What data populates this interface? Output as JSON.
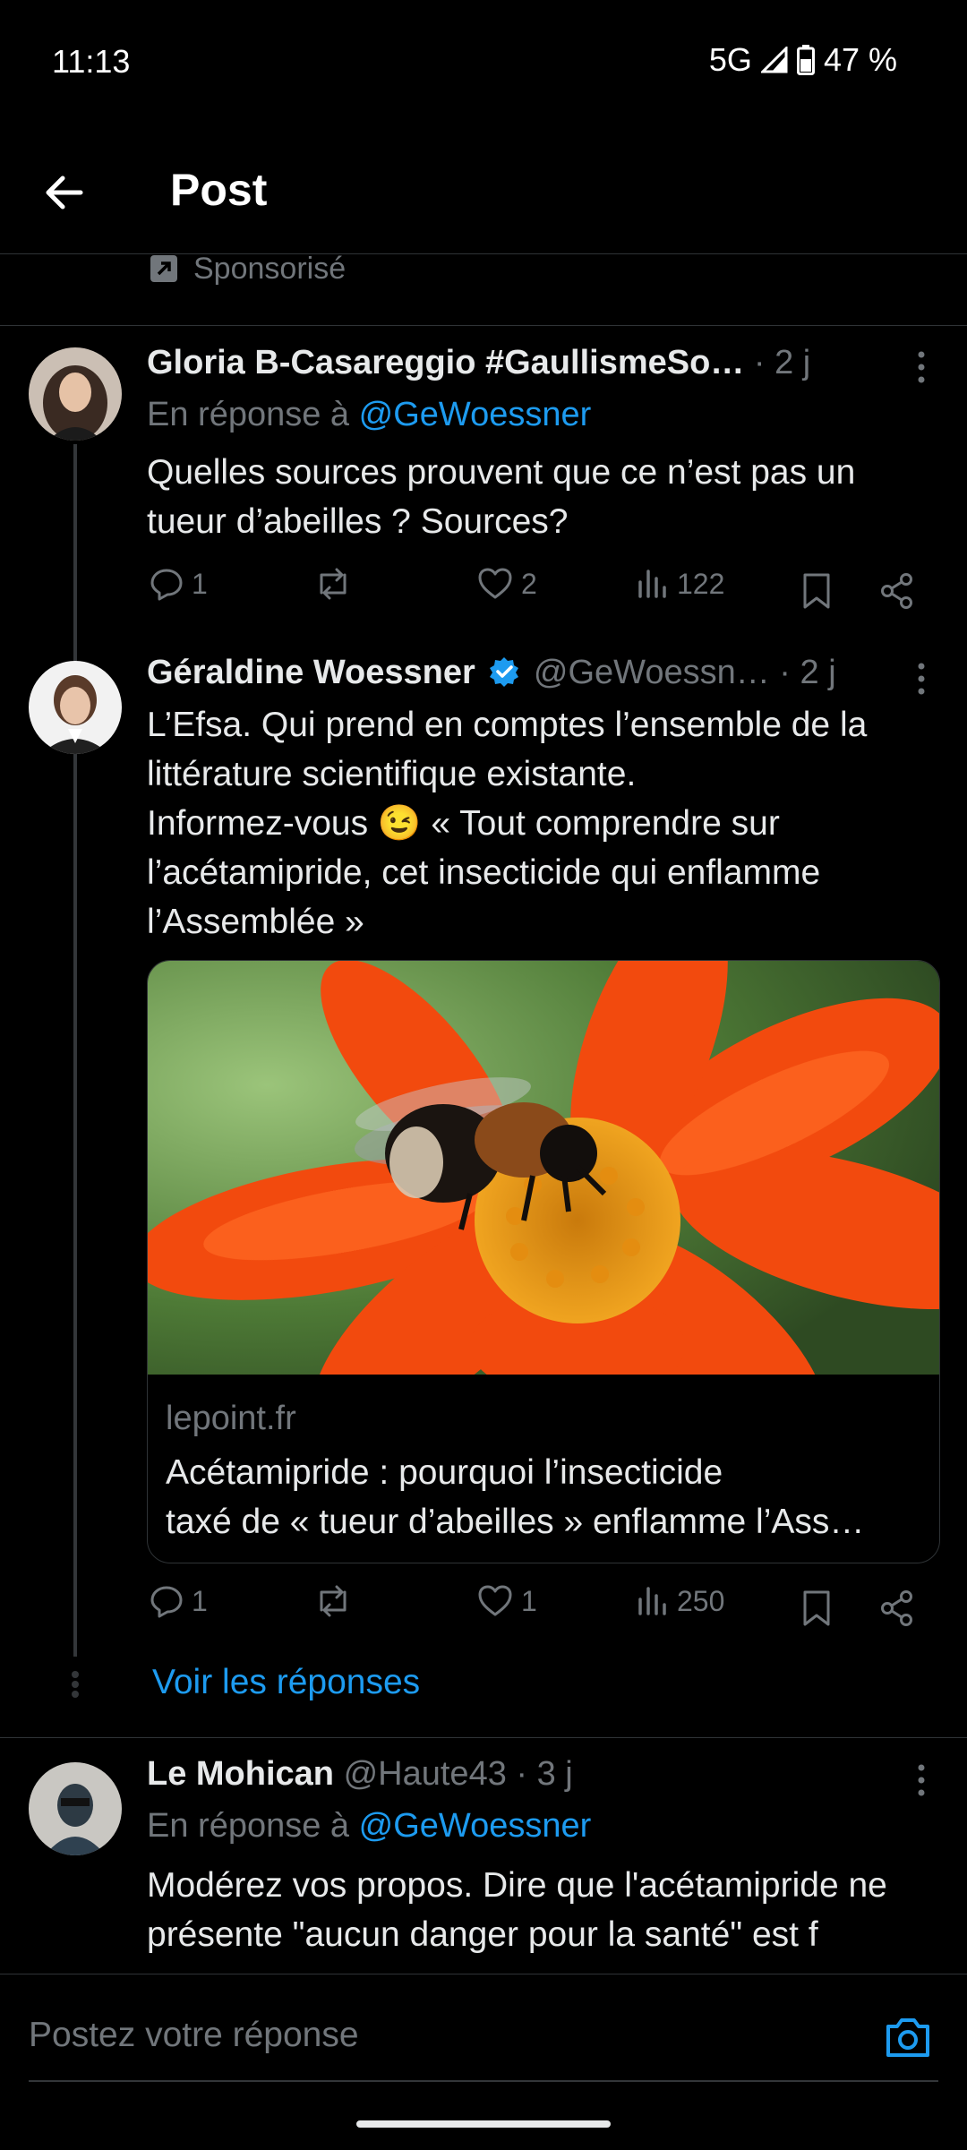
{
  "status_bar": {
    "time": "11:13",
    "network": "5G",
    "battery": "47 %"
  },
  "header": {
    "title": "Post"
  },
  "sponsored": {
    "label": "Sponsorisé"
  },
  "reply_prefix": "En réponse à",
  "tweets": [
    {
      "name": "Gloria B-Casareggio #GaullismeSo…",
      "meta": " · 2 j",
      "reply_handle": "@GeWoessner",
      "text": "Quelles sources prouvent que ce n’est pas un tueur d’abeilles ? Sources?",
      "replies": "1",
      "reposts": "",
      "likes": "2",
      "views": "122"
    },
    {
      "name": "Géraldine Woessner",
      "verified": true,
      "meta": "@GeWoessn… · 2 j",
      "text_line1": "L’Efsa. Qui prend en comptes l’ensemble de la littérature scientifique existante.",
      "text_line2_before": "Informez-vous ",
      "emoji": "😉",
      "text_line2_after": " « Tout comprendre sur l’acétamipride, cet insecticide qui enflamme l’Assemblée »",
      "card": {
        "domain": "lepoint.fr",
        "title_line1": "Acétamipride : pourquoi l’insecticide",
        "title_line2": "taxé de « tueur d’abeilles » enflamme l’Ass…"
      },
      "replies": "1",
      "reposts": "",
      "likes": "1",
      "views": "250",
      "show_replies": "Voir les réponses"
    },
    {
      "name": "Le Mohican",
      "meta": "@Haute43 · 3 j",
      "reply_handle": "@GeWoessner",
      "text": "Modérez vos propos. Dire que l'acétamipride ne présente \"aucun danger pour la santé\" est f"
    }
  ],
  "composer": {
    "placeholder": "Postez votre réponse"
  },
  "colors": {
    "accent": "#1d9bf0",
    "muted": "#71767b",
    "background": "#000000"
  }
}
